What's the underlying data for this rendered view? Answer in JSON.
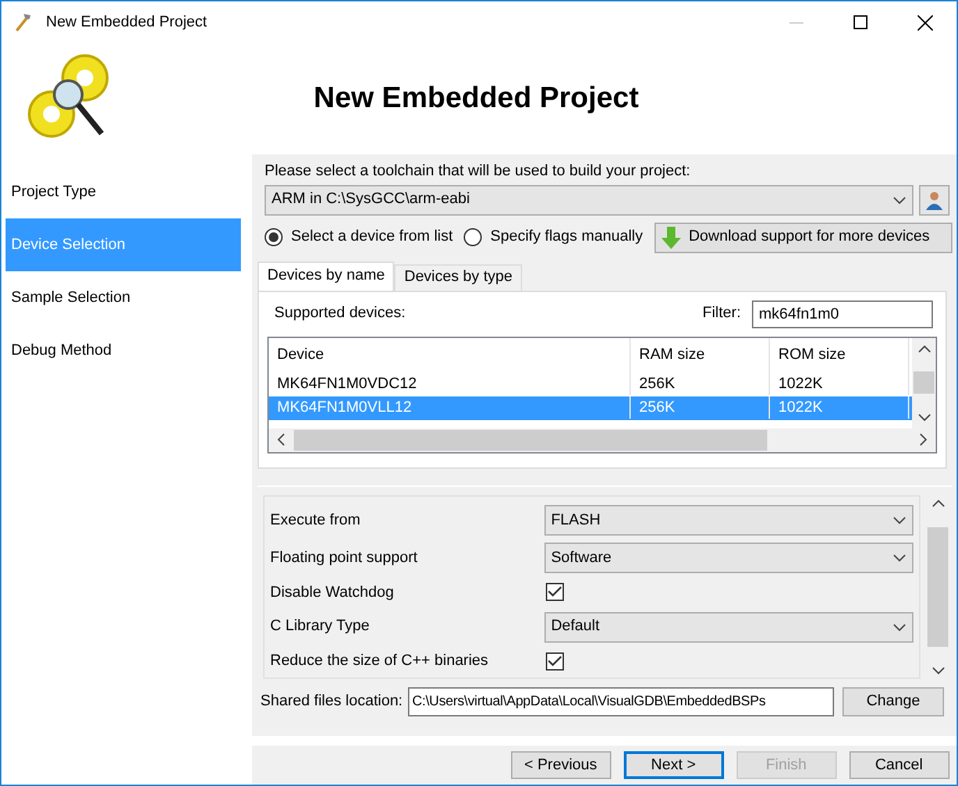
{
  "window": {
    "title": "New Embedded Project",
    "minimize_disabled": true
  },
  "header": {
    "title": "New Embedded Project"
  },
  "sidebar": {
    "items": [
      {
        "label": "Project Type",
        "selected": false
      },
      {
        "label": "Device Selection",
        "selected": true
      },
      {
        "label": "Sample Selection",
        "selected": false
      },
      {
        "label": "Debug Method",
        "selected": false
      }
    ]
  },
  "toolchain": {
    "label": "Please select a toolchain that will be used to build your project:",
    "value": "ARM in C:\\SysGCC\\arm-eabi"
  },
  "modes": [
    {
      "label": "Select a device from list",
      "selected": true
    },
    {
      "label": "Specify flags manually",
      "selected": false
    }
  ],
  "download_button": "Download support for more devices",
  "tabs": [
    {
      "label": "Devices by name",
      "selected": true
    },
    {
      "label": "Devices by type",
      "selected": false
    }
  ],
  "devices": {
    "label": "Supported devices:",
    "filter_label": "Filter:",
    "filter_value": "mk64fn1m0",
    "columns": [
      "Device",
      "RAM size",
      "ROM size"
    ],
    "rows": [
      {
        "cells": [
          "MK64FN1M0VDC12",
          "256K",
          "1022K"
        ],
        "selected": false
      },
      {
        "cells": [
          "MK64FN1M0VLL12",
          "256K",
          "1022K"
        ],
        "selected": true
      }
    ]
  },
  "settings": [
    {
      "kind": "dropdown",
      "label": "Execute from",
      "value": "FLASH"
    },
    {
      "kind": "dropdown",
      "label": "Floating point support",
      "value": "Software"
    },
    {
      "kind": "checkbox",
      "label": "Disable Watchdog",
      "checked": true
    },
    {
      "kind": "dropdown",
      "label": "C Library Type",
      "value": "Default"
    },
    {
      "kind": "checkbox",
      "label": "Reduce the size of C++ binaries",
      "checked": true
    }
  ],
  "shared_files": {
    "label": "Shared files location:",
    "value": "C:\\Users\\virtual\\AppData\\Local\\VisualGDB\\EmbeddedBSPs",
    "button": "Change"
  },
  "buttons": [
    {
      "label": "< Previous",
      "disabled": false,
      "default": false
    },
    {
      "label": "Next >",
      "disabled": false,
      "default": true
    },
    {
      "label": "Finish",
      "disabled": true,
      "default": false
    },
    {
      "label": "Cancel",
      "disabled": false,
      "default": false
    }
  ]
}
